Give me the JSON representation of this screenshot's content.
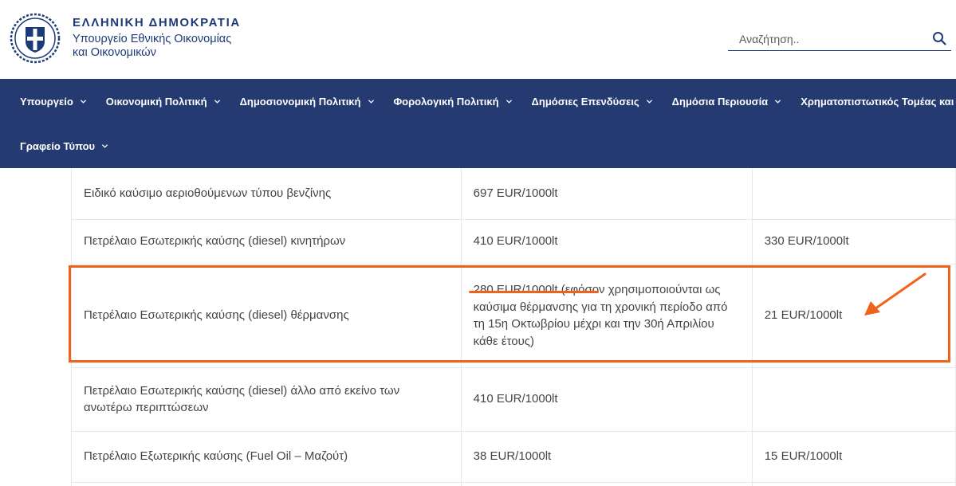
{
  "header": {
    "title": "ΕΛΛΗΝΙΚΗ ΔΗΜΟΚΡΑΤΙΑ",
    "subtitle_line1": "Υπουργείο Εθνικής Οικονομίας",
    "subtitle_line2": "και Οικονομικών",
    "logo_icon": "greek-coat-of-arms-seal"
  },
  "search": {
    "placeholder": "Αναζήτηση..",
    "icon": "search-icon"
  },
  "nav": {
    "row1": [
      "Υπουργείο",
      "Οικονομική Πολιτική",
      "Δημοσιονομική Πολιτική",
      "Φορολογική Πολιτική",
      "Δημόσιες Επενδύσεις",
      "Δημόσια Περιουσία",
      "Χρηματοπιστωτικός Τομέας και Διαχε"
    ],
    "row2": [
      "Γραφείο Τύπου"
    ]
  },
  "table": {
    "rows": [
      {
        "product": "Ειδικό καύσιμο αεριοθούμενων τύπου βενζίνης",
        "rate": "697 EUR/1000lt",
        "reduced": ""
      },
      {
        "product": "Πετρέλαιο Εσωτερικής καύσης (diesel) κινητήρων",
        "rate": "410 EUR/1000lt",
        "reduced": "330 EUR/1000lt"
      },
      {
        "product": "Πετρέλαιο Εσωτερικής καύσης (diesel) θέρμανσης",
        "rate": "280 EUR/1000lt (εφόσον χρησιμοποιούνται ως καύσιμα θέρμανσης για τη χρονική περίοδο από τη 15η Οκτωβρίου μέχρι και την 30ή Απριλίου κάθε έτους)",
        "reduced": "21 EUR/1000lt"
      },
      {
        "product": "Πετρέλαιο Εσωτερικής καύσης (diesel) άλλο από εκείνο των ανωτέρω περιπτώσεων",
        "rate": "410 EUR/1000lt",
        "reduced": ""
      },
      {
        "product": "Πετρέλαιο Εξωτερικής καύσης (Fuel  Oil – Μαζούτ)",
        "rate": "38 EUR/1000lt",
        "reduced": "15 EUR/1000lt"
      }
    ]
  },
  "annotations": {
    "color": "#f06219"
  },
  "colors": {
    "brand": "#1d3a78",
    "nav_bg": "#253a70"
  }
}
